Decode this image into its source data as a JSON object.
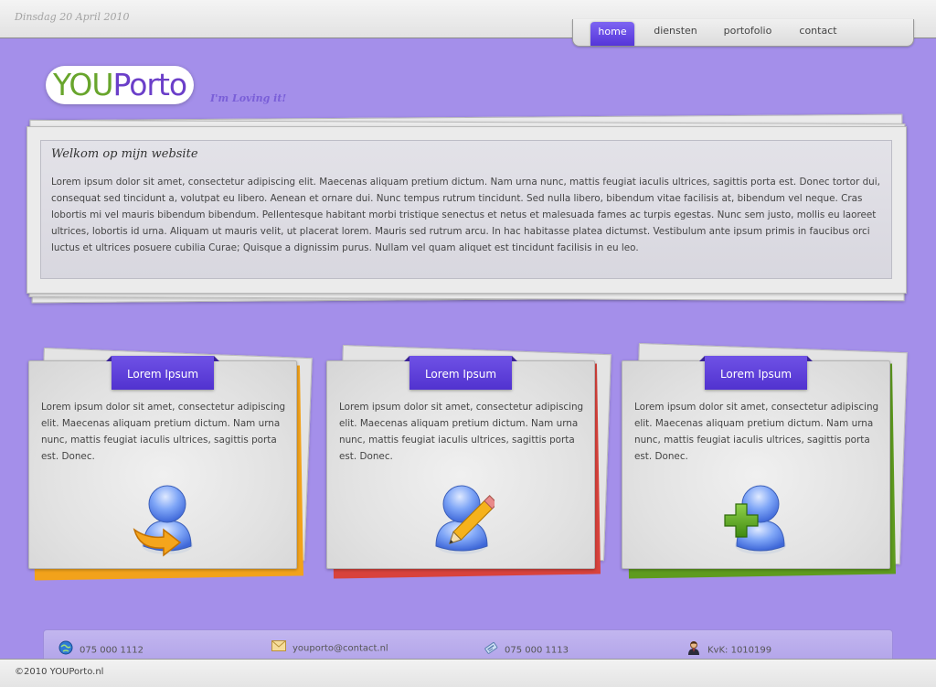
{
  "header": {
    "date": "Dinsdag 20 April 2010",
    "nav": [
      {
        "label": "home",
        "active": true
      },
      {
        "label": "diensten",
        "active": false
      },
      {
        "label": "portofolio",
        "active": false
      },
      {
        "label": "contact",
        "active": false
      }
    ]
  },
  "logo": {
    "you": "YOU",
    "porto": "Porto",
    "tagline": "I'm Loving it!"
  },
  "welcome": {
    "title": "Welkom op mijn website",
    "text": "Lorem ipsum dolor sit amet, consectetur adipiscing elit. Maecenas aliquam pretium dictum. Nam urna nunc, mattis feugiat iaculis ultrices, sagittis porta est. Donec tortor dui, consequat sed tincidunt a, volutpat eu libero. Aenean et ornare dui. Nunc tempus rutrum tincidunt. Sed nulla libero, bibendum vitae facilisis at, bibendum vel neque. Cras lobortis mi vel mauris bibendum bibendum. Pellentesque habitant morbi tristique senectus et netus et malesuada fames ac turpis egestas. Nunc sem justo, mollis eu laoreet ultrices, lobortis id urna. Aliquam ut mauris velit, ut placerat lorem. Mauris sed rutrum arcu. In hac habitasse platea dictumst. Vestibulum ante ipsum primis in faucibus orci luctus et ultrices posuere cubilia Curae; Quisque a dignissim purus. Nullam vel quam aliquet est tincidunt facilisis in eu leo."
  },
  "boxes": [
    {
      "title": "Lorem Ipsum",
      "text": "Lorem ipsum dolor sit amet, consectetur adipiscing elit. Maecenas aliquam pretium dictum. Nam urna nunc, mattis feugiat iaculis ultrices, sagittis porta est. Donec.",
      "accent": "#f2a21b",
      "icon": "user-arrow-icon"
    },
    {
      "title": "Lorem Ipsum",
      "text": "Lorem ipsum dolor sit amet, consectetur adipiscing elit. Maecenas aliquam pretium dictum. Nam urna nunc, mattis feugiat iaculis ultrices, sagittis porta est. Donec.",
      "accent": "#d8423c",
      "icon": "user-edit-icon"
    },
    {
      "title": "Lorem Ipsum",
      "text": "Lorem ipsum dolor sit amet, consectetur adipiscing elit. Maecenas aliquam pretium dictum. Nam urna nunc, mattis feugiat iaculis ultrices, sagittis porta est. Donec.",
      "accent": "#5e9b1e",
      "icon": "user-add-icon"
    }
  ],
  "footer": {
    "phone": "075 000 1112",
    "email": "youporto@contact.nl",
    "fax": "075 000 1113",
    "kvk": "KvK: 1010199",
    "copyright": "©2010 YOUPorto.nl"
  },
  "colors": {
    "background": "#a48fea",
    "accent": "#5a3ad9"
  }
}
